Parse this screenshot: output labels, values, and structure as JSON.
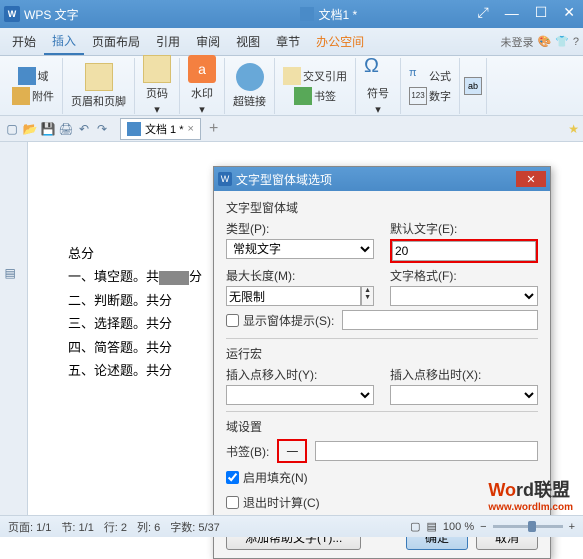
{
  "titlebar": {
    "app": "W",
    "title": "WPS 文字",
    "doc": "文档1 *"
  },
  "menu": {
    "tabs": [
      "开始",
      "插入",
      "页面布局",
      "引用",
      "审阅",
      "视图",
      "章节",
      "办公空间"
    ],
    "active_index": 1,
    "login": "未登录"
  },
  "ribbon": {
    "group1_a": "域",
    "group1_b": "附件",
    "group2": "页眉和页脚",
    "group3": "页码",
    "group4": "水印",
    "group5": "超链接",
    "group6_a": "交叉引用",
    "group6_b": "书签",
    "group7": "符号",
    "group8_a": "公式",
    "group8_b": "数字"
  },
  "tabbar": {
    "doc": "文档 1 *"
  },
  "document": {
    "l1_pre": "总分",
    "l2_pre": "一、填空题。共",
    "l2_post": "分",
    "l3": "二、判断题。共分",
    "l4": "三、选择题。共分",
    "l5": "四、简答题。共分",
    "l6": "五、论述题。共分"
  },
  "dialog": {
    "title": "文字型窗体域选项",
    "section1": "文字型窗体域",
    "type_label": "类型(P):",
    "type_value": "常规文字",
    "default_label": "默认文字(E):",
    "default_value": "20",
    "maxlen_label": "最大长度(M):",
    "maxlen_value": "无限制",
    "format_label": "文字格式(F):",
    "show_prompt": "显示窗体提示(S):",
    "section2": "运行宏",
    "macro_in": "插入点移入时(Y):",
    "macro_out": "插入点移出时(X):",
    "section3": "域设置",
    "bookmark_label": "书签(B):",
    "bookmark_value": "一",
    "enable_fill": "启用填充(N)",
    "exit_calc": "退出时计算(C)",
    "help_btn": "添加帮助文字(T)...",
    "ok": "确定",
    "cancel": "取消"
  },
  "status": {
    "page": "页面: 1/1",
    "section": "节: 1/1",
    "row": "行: 2",
    "col": "列: 6",
    "chars": "字数: 5/37",
    "zoom": "100 %"
  },
  "watermark": {
    "brand1": "Wo",
    "brand2": "rd联盟",
    "url": "www.wordlm.com"
  }
}
